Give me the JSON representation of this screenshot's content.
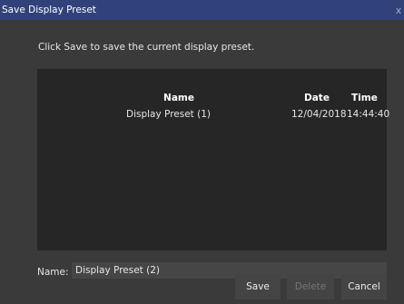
{
  "window": {
    "title": "Save Display Preset",
    "close_glyph": "x"
  },
  "instruction": "Click Save to save the current display preset.",
  "table": {
    "columns": [
      "Name",
      "Date",
      "Time"
    ],
    "rows": [
      {
        "name": "Display Preset (1)",
        "date": "12/04/2018",
        "time": "14:44:40"
      }
    ]
  },
  "name_field": {
    "label": "Name:",
    "value": "Display Preset (2)"
  },
  "buttons": {
    "save": "Save",
    "delete": "Delete",
    "cancel": "Cancel"
  },
  "colors": {
    "titlebar": "#31427a",
    "dialog_background": "#3a3a3a",
    "table_background": "#262626"
  }
}
